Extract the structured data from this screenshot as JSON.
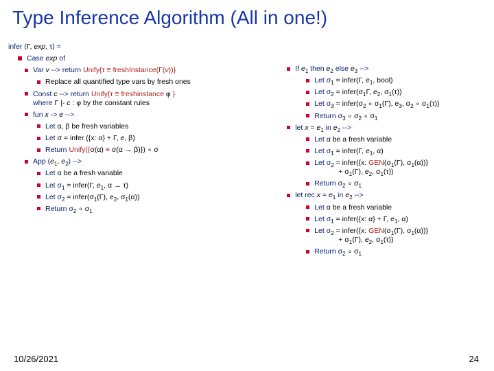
{
  "title": "Type Inference Algorithm (All in one!)",
  "footer": {
    "date": "10/26/2021",
    "page": "24"
  },
  "left": {
    "infer_sig_pre": "infer (",
    "infer_sig_gamma": "Γ",
    "infer_sig_mid1": ", ",
    "infer_sig_exp": "exp",
    "infer_sig_mid2": ", ",
    "infer_sig_tau": "τ",
    "infer_sig_post": ") =",
    "case_pre": "Case ",
    "case_exp": "exp",
    "case_post": " of",
    "var_pre": "Var  ",
    "var_v": "v",
    "var_arrow": " --> ",
    "var_ret": " return ",
    "var_unify": "Unify{τ ≡ freshInstance(Γ(",
    "var_v2": "v",
    "var_close": "))}",
    "var_note": "Replace all quantified type vars by fresh ones",
    "const_pre": "Const  ",
    "const_c": "c",
    "const_arrow": " --> ",
    "const_ret": " return ",
    "const_unify": "Unify{τ ≡ freshinstance ",
    "const_phi": "φ",
    "const_close": " }",
    "const_where_pre": "where ",
    "const_where_gamma": "Γ |- ",
    "const_where_c": "c",
    "const_where_post": " : φ by the constant rules",
    "fun_pre": "fun ",
    "fun_x": "x",
    "fun_arrow": " -> ",
    "fun_e": "e",
    "fun_post": " -->",
    "fun1_pre": "Let ",
    "fun1_ab": "α, β",
    "fun1_post": " be fresh variables",
    "fun2_pre": "Let ",
    "fun2_sig": "σ",
    "fun2_mid": " = infer ({x: ",
    "fun2_a": "α",
    "fun2_mid2": "} + ",
    "fun2_g": "Γ",
    "fun2_mid3": ", ",
    "fun2_e": "e",
    "fun2_mid4": ", ",
    "fun2_b": "β",
    "fun2_close": ")",
    "fun3_pre": "Return ",
    "fun3_u1": "Unify({",
    "fun3_sa": "σ(α)",
    "fun3_eq": " ≡ ",
    "fun3_sab": "σ(α → β)})",
    "fun3_comp": " ∘ ",
    "fun3_sig": "σ",
    "app_pre": "App (",
    "app_e1": "e",
    "app_sep": ", ",
    "app_e2": "e",
    "app_post": ") -->",
    "app1_pre": "Let ",
    "app1_a": "α",
    "app1_post": " be a fresh variable",
    "app2_pre": "Let σ",
    "app2_mid": " = infer(Γ, ",
    "app2_e": "e",
    "app2_mid2": ", ",
    "app2_at": "α → τ",
    "app2_close": ")",
    "app3_pre": "Let σ",
    "app3_mid": " = infer(σ",
    "app3_g": "(Γ), ",
    "app3_e": "e",
    "app3_mid2": ", ",
    "app3_sa": "σ",
    "app3_close": "(α))",
    "app4_pre": "Return σ",
    "app4_comp": " ∘ σ"
  },
  "right": {
    "if_pre": "If ",
    "if_e1": "e",
    "if_then": " then ",
    "if_e2": "e",
    "if_else": " else ",
    "if_e3": "e",
    "if_post": " -->",
    "if1_pre": "Let σ",
    "if1_mid": " = infer(Γ, ",
    "if1_e": "e",
    "if1_post": ", bool)",
    "if2_pre": "Let σ",
    "if2_mid": " = infer(σ",
    "if2_g": "Γ, ",
    "if2_e": "e",
    "if2_mid2": ", σ",
    "if2_t": "(τ))",
    "if3_pre": "Let σ",
    "if3_mid": " = infer(σ",
    "if3_o": " ∘ σ",
    "if3_g": "(Γ), e",
    "if3_mid2": ", σ",
    "if3_o2": " ∘ σ",
    "if3_t": "(τ))",
    "if4_pre": "Return σ",
    "if4_o": " ∘ σ",
    "if4_o2": " ∘ σ",
    "let_pre": "let ",
    "let_x": "x",
    "let_eq": " = ",
    "let_e1": "e",
    "let_in": " in ",
    "let_e2": "e",
    "let_post": " -->",
    "let1_pre": "Let ",
    "let1_a": "α",
    "let1_post": " be a fresh variable",
    "let2_pre": "Let σ",
    "let2_mid": " = infer(Γ, ",
    "let2_e": "e",
    "let2_mid2": ", ",
    "let2_a": "α",
    "let2_close": ")",
    "let3_pre": "Let σ",
    "let3_mid": " = infer(",
    "let3_x": "{x: ",
    "let3_gen": "GEN",
    "let3_g": "(σ",
    "let3_gc": "(Γ), σ",
    "let3_ac": "(α))}",
    "let3_line2_pre": "+ σ",
    "let3_line2_g": "(Γ), ",
    "let3_line2_e": "e",
    "let3_line2_mid": ", σ",
    "let3_line2_t": "(τ))",
    "let4_pre": "Return σ",
    "let4_o": " ∘ σ",
    "lr_pre": "let rec ",
    "lr_x": "x",
    "lr_eq": " = ",
    "lr_e1": "e",
    "lr_in": " in ",
    "lr_e2": "e",
    "lr_post": " -->",
    "lr1_pre": "Let ",
    "lr1_a": "α",
    "lr1_post": " be a fresh variable",
    "lr2_pre": "Let σ",
    "lr2_mid": " = infer({x: ",
    "lr2_a": "α",
    "lr2_mid2": "} + Γ, ",
    "lr2_e": "e",
    "lr2_mid3": ", ",
    "lr2_a2": "α",
    "lr2_close": ")",
    "lr3_pre": "Let σ",
    "lr3_mid": " = infer({x: ",
    "lr3_gen": "GEN",
    "lr3_g": "(σ",
    "lr3_gc": "(Γ), σ",
    "lr3_ac": "(α))}",
    "lr3_line2_pre": "+ σ",
    "lr3_line2_g": "(Γ), ",
    "lr3_line2_e": "e",
    "lr3_line2_mid": ", σ",
    "lr3_line2_t": "(τ))",
    "lr4_pre": "Return σ",
    "lr4_o": " ∘ σ"
  }
}
